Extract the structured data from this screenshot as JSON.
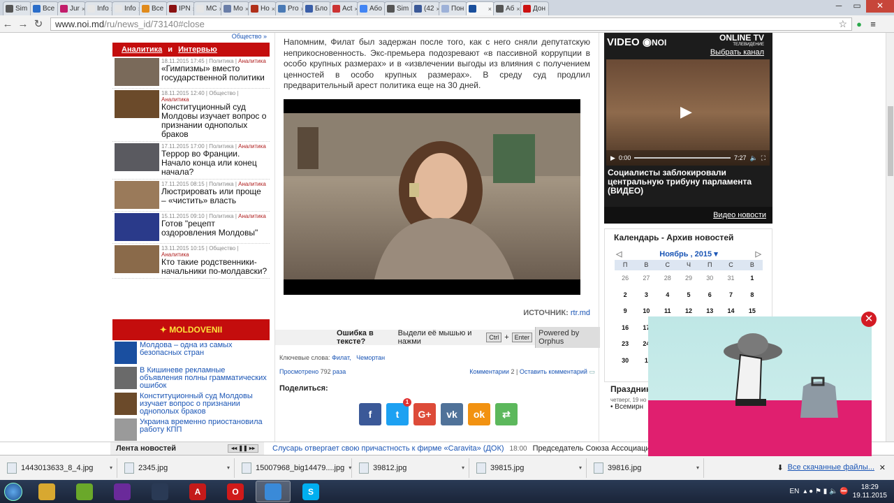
{
  "browser": {
    "tabs": [
      {
        "label": "Sim",
        "icon": "stack-icon",
        "color": "#555555"
      },
      {
        "label": "Все",
        "icon": "mail-icon",
        "color": "#2a6dc9"
      },
      {
        "label": "Jur",
        "icon": "j-icon",
        "color": "#c21d6b"
      },
      {
        "label": "Info",
        "icon": "doc-icon",
        "color": "#e6e6e6"
      },
      {
        "label": "Info",
        "icon": "doc-icon",
        "color": "#e6e6e6"
      },
      {
        "label": "Все",
        "icon": "pencil-icon",
        "color": "#e08a1b"
      },
      {
        "label": "IPN",
        "icon": "ipn-icon",
        "color": "#8a1010"
      },
      {
        "label": "MC",
        "icon": "doc-icon",
        "color": "#e6e6e6"
      },
      {
        "label": "Mo",
        "icon": "m-icon",
        "color": "#6a7ea8"
      },
      {
        "label": "Ho",
        "icon": "crest-icon",
        "color": "#b0301a"
      },
      {
        "label": "Pro",
        "icon": "globe-icon",
        "color": "#4a7ab5"
      },
      {
        "label": "Бло",
        "icon": "b-icon",
        "color": "#3a5ea8"
      },
      {
        "label": "Act",
        "icon": "pen-icon",
        "color": "#c33"
      },
      {
        "label": "Або",
        "icon": "google-icon",
        "color": "#4285f4"
      },
      {
        "label": "Sim",
        "icon": "stack-icon",
        "color": "#555555"
      },
      {
        "label": "(42",
        "icon": "facebook-icon",
        "color": "#3b5998"
      },
      {
        "label": "Пон",
        "icon": "doc-icon",
        "color": "#9db1d8"
      },
      {
        "label": "",
        "icon": "noi-icon",
        "color": "#1a4f9c",
        "active": true
      },
      {
        "label": "Аб",
        "icon": "stack-icon",
        "color": "#555555"
      },
      {
        "label": "Дон",
        "icon": "rtr-icon",
        "color": "#cc1111"
      }
    ],
    "url_host": "www.noi.md",
    "url_path": "/ru/news_id/73140#close"
  },
  "left": {
    "top_link": "Общество »",
    "header_a": "Аналитика",
    "header_and": "и",
    "header_b": "Интервью",
    "news": [
      {
        "meta": "18.11.2015 17:45 | Политика |",
        "cat": "Аналитика",
        "title": "«Гимпизмы» вместо государственной политики",
        "thumb": "#7a6a5a"
      },
      {
        "meta": "18.11.2015 12:40 | Общество |",
        "cat": "Аналитика",
        "title": "Конституционный суд Молдовы изучает вопрос о признании однополых браков",
        "thumb": "#6b4a2a"
      },
      {
        "meta": "17.11.2015 17:00 | Политика |",
        "cat": "Аналитика",
        "title": "Террор во Франции. Начало конца или конец начала?",
        "thumb": "#5a5a60"
      },
      {
        "meta": "17.11.2015 08:15 | Политика |",
        "cat": "Аналитика",
        "title": "Люстрировать или проще – «чистить» власть",
        "thumb": "#9a7a5a"
      },
      {
        "meta": "15.11.2015 09:10 | Политика |",
        "cat": "Аналитика",
        "title": "Готов \"рецепт оздоровления Молдовы\"",
        "thumb": "#2a3a8a"
      },
      {
        "meta": "13.11.2015 10:15 | Общество |",
        "cat": "Аналитика",
        "title": "Кто такие родственники-начальники по-молдавски?",
        "thumb": "#8a6a4a"
      }
    ],
    "moldovenii_title": "MOLDOVENII",
    "moldovenii": [
      {
        "title": "Молдова – одна из самых безопасных стран",
        "thumb": "#1a4fa0"
      },
      {
        "title": "В Кишиневе рекламные объявления полны грамматических ошибок",
        "thumb": "#6a6a6a"
      },
      {
        "title": "Конституционный суд Молдовы изучает вопрос о признании однополых браков",
        "thumb": "#6b4a2a"
      },
      {
        "title": "Украина временно приостановила работу КПП",
        "thumb": "#9a9a9a"
      }
    ]
  },
  "article": {
    "text": "Напомним, Филат был задержан после того, как с него сняли депутатскую неприкосновенность. Экс-премьера подозревают «в пассивной коррупции в особо крупных размерах» и в «извлечении выгоды из влияния с получением ценностей в особо крупных размерах». В среду суд продлил предварительный арест политика еще на 30 дней.",
    "source_label": "ИСТОЧНИК:",
    "source_link": "rtr.md",
    "orphus_q": "Ошибка в тексте?",
    "orphus_hint": "Выдели её мышью и нажми",
    "key_ctrl": "Ctrl",
    "plus": "+",
    "key_enter": "Enter",
    "powered": "Powered by Orphus",
    "keywords_label": "Ключевые слова:",
    "keywords": [
      "Филат,",
      "Чемортан"
    ],
    "views_label": "Просмотрено",
    "views": "792",
    "views_unit": "раза",
    "comments_label": "Комментарии",
    "comments": "2",
    "leave_comment": "Оставить комментарий",
    "share_label": "Поделиться:",
    "social": [
      {
        "icon": "facebook-icon",
        "glyph": "f",
        "color": "#3b5998"
      },
      {
        "icon": "twitter-icon",
        "glyph": "t",
        "color": "#1da1f2",
        "badge": "1"
      },
      {
        "icon": "googleplus-icon",
        "glyph": "G+",
        "color": "#dd4b39"
      },
      {
        "icon": "vk-icon",
        "glyph": "vk",
        "color": "#507299"
      },
      {
        "icon": "odnoklassniki-icon",
        "glyph": "ok",
        "color": "#f29211"
      },
      {
        "icon": "share-icon",
        "glyph": "⇄",
        "color": "#5cb85c"
      }
    ]
  },
  "right": {
    "video_title": "VIDEO",
    "video_brand": "NOI",
    "online_tv": "ONLINE TV",
    "tv_sub": "ТЕЛЕВИДЕНИЕ",
    "choose_channel": "Выбрать канал",
    "time_cur": "0:00",
    "time_total": "7:27",
    "video_caption": "Социалисты заблокировали центральную трибуну парламента (ВИДЕО)",
    "video_news": "Видео новости",
    "calendar_title": "Календарь - Архив новостей",
    "month": "Ноябрь , 2015",
    "weekdays": [
      "П",
      "В",
      "С",
      "Ч",
      "П",
      "С",
      "В"
    ],
    "weeks": [
      [
        "26",
        "27",
        "28",
        "29",
        "30",
        "31",
        "1"
      ],
      [
        "2",
        "3",
        "4",
        "5",
        "6",
        "7",
        "8"
      ],
      [
        "9",
        "10",
        "11",
        "12",
        "13",
        "14",
        "15"
      ],
      [
        "16",
        "17",
        "",
        "",
        "",
        "",
        ""
      ],
      [
        "23",
        "24",
        "",
        "",
        "",
        "",
        ""
      ],
      [
        "30",
        "1",
        "",
        "",
        "",
        "",
        ""
      ]
    ],
    "holidays_title": "Праздник",
    "holidays_date": "четверг, 19 но",
    "holidays_item": "• Всемирн"
  },
  "ticker": {
    "label": "Лента новостей",
    "item1": "Слусарь отвергает свою причастность к фирме «Caravita» (ДОК)",
    "time2": "18:00",
    "item2": "Председатель Союза Ассоциаций сельхозпроизводителей"
  },
  "downloads": {
    "files": [
      "1443013633_8_4.jpg",
      "2345.jpg",
      "15007968_big14479....jpg",
      "39812.jpg",
      "39815.jpg",
      "39816.jpg"
    ],
    "all": "Все скачанные файлы..."
  },
  "taskbar": {
    "lang": "EN",
    "time": "18:29",
    "date": "19.11.2015",
    "apps": [
      {
        "icon": "explorer-icon",
        "color": "#d8a830"
      },
      {
        "icon": "nvidia-icon",
        "color": "#6aa82a"
      },
      {
        "icon": "visualstudio-icon",
        "color": "#6a2a9a"
      },
      {
        "icon": "steam-icon",
        "color": "#2a3a55"
      },
      {
        "icon": "acrobat-icon",
        "color": "#c41a1a",
        "glyph": "A"
      },
      {
        "icon": "opera-icon",
        "color": "#d01a1a",
        "glyph": "O"
      },
      {
        "icon": "chrome-icon",
        "color": "#3a8ad8",
        "active": true
      },
      {
        "icon": "skype-icon",
        "color": "#00aff0",
        "glyph": "S"
      }
    ]
  }
}
